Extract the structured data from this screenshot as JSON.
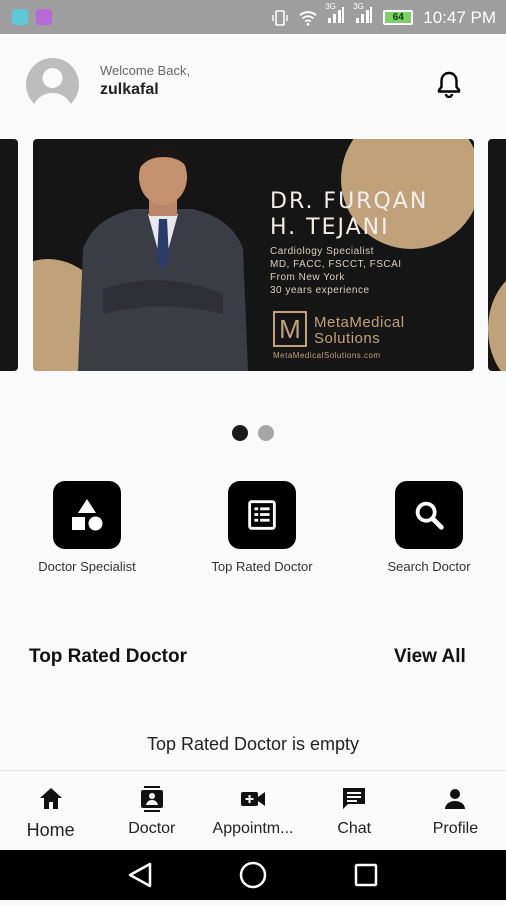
{
  "status_bar": {
    "time": "10:47 PM",
    "battery": "64",
    "network_1": "3G",
    "network_2": "3G"
  },
  "header": {
    "welcome": "Welcome Back,",
    "username": "zulkafal"
  },
  "banner": {
    "doctor_name_line1": "DR. FURQAN",
    "doctor_name_line2": "H. TEJANI",
    "info_lines": [
      "Cardiology Specialist",
      "MD, FACC, FSCCT, FSCAI",
      "From New York",
      "30 years experience"
    ],
    "logo_letter": "M",
    "logo_line1": "MetaMedical",
    "logo_line2": "Solutions",
    "website": "MetaMedicalSolutions.com",
    "slides": 2,
    "active_slide": 1
  },
  "quick_actions": [
    {
      "label": "Doctor Specialist",
      "icon": "category-shapes-icon"
    },
    {
      "label": "Top Rated Doctor",
      "icon": "list-article-icon"
    },
    {
      "label": "Search Doctor",
      "icon": "search-icon"
    }
  ],
  "section": {
    "title": "Top Rated Doctor",
    "view_all": "View All",
    "empty_text": "Top Rated Doctor is empty"
  },
  "bottom_nav": [
    {
      "label": "Home",
      "icon": "home-icon"
    },
    {
      "label": "Doctor",
      "icon": "contact-card-icon"
    },
    {
      "label": "Appointm...",
      "icon": "video-camera-icon"
    },
    {
      "label": "Chat",
      "icon": "chat-icon"
    },
    {
      "label": "Profile",
      "icon": "person-icon"
    }
  ],
  "colors": {
    "accent_tan": "#c0a27a",
    "banner_bg": "#151515",
    "icon_tile": "#000000"
  }
}
